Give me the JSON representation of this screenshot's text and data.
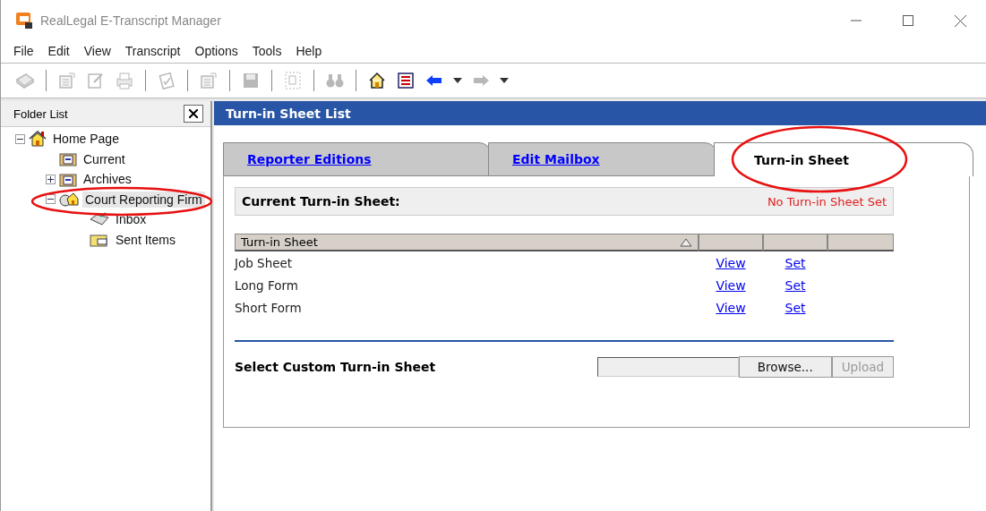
{
  "window": {
    "title": "RealLegal E-Transcript Manager"
  },
  "menu": [
    "File",
    "Edit",
    "View",
    "Transcript",
    "Options",
    "Tools",
    "Help"
  ],
  "toolbar": [
    {
      "kind": "book",
      "disabled": true
    },
    {
      "kind": "separator"
    },
    {
      "kind": "doc",
      "disabled": true
    },
    {
      "kind": "edit",
      "disabled": true
    },
    {
      "kind": "print",
      "disabled": true
    },
    {
      "kind": "separator"
    },
    {
      "kind": "check",
      "disabled": true
    },
    {
      "kind": "separator"
    },
    {
      "kind": "doc",
      "disabled": true
    },
    {
      "kind": "separator"
    },
    {
      "kind": "save",
      "disabled": true
    },
    {
      "kind": "separator"
    },
    {
      "kind": "copy",
      "disabled": true
    },
    {
      "kind": "separator"
    },
    {
      "kind": "find",
      "disabled": true
    },
    {
      "kind": "separator"
    },
    {
      "kind": "home",
      "disabled": false
    },
    {
      "kind": "list",
      "disabled": false
    },
    {
      "kind": "back",
      "disabled": false
    },
    {
      "kind": "dropdown"
    },
    {
      "kind": "forward",
      "disabled": true
    },
    {
      "kind": "dropdown"
    }
  ],
  "sidebar": {
    "title": "Folder List",
    "tree": [
      {
        "label": "Home Page",
        "kind": "home",
        "expanded": true,
        "selected": false,
        "children": [
          {
            "label": "Current",
            "kind": "folder",
            "selected": false
          },
          {
            "label": "Archives",
            "kind": "folder",
            "expanded": false,
            "selected": false
          },
          {
            "label": "Court Reporting Firm",
            "kind": "firm",
            "expanded": true,
            "selected": true,
            "children": [
              {
                "label": "Inbox",
                "kind": "inbox",
                "selected": false
              },
              {
                "label": "Sent Items",
                "kind": "sent",
                "selected": false
              }
            ]
          }
        ]
      }
    ]
  },
  "panel": {
    "title": "Turn-in Sheet List",
    "tabs": [
      {
        "label": "Reporter Editions",
        "selected": false
      },
      {
        "label": "Edit Mailbox",
        "selected": false
      },
      {
        "label": "Turn-in Sheet",
        "selected": true
      }
    ],
    "current": {
      "label": "Current Turn-in Sheet:",
      "status": "No Turn-in Sheet Set"
    },
    "table": {
      "columns": [
        "Turn-in Sheet"
      ],
      "rows": [
        {
          "name": "Job Sheet",
          "view": "View",
          "set": "Set"
        },
        {
          "name": "Long Form",
          "view": "View",
          "set": "Set"
        },
        {
          "name": "Short Form",
          "view": "View",
          "set": "Set"
        }
      ]
    },
    "custom": {
      "label": "Select Custom Turn-in Sheet",
      "browse": "Browse...",
      "upload": "Upload",
      "upload_disabled": true
    }
  }
}
